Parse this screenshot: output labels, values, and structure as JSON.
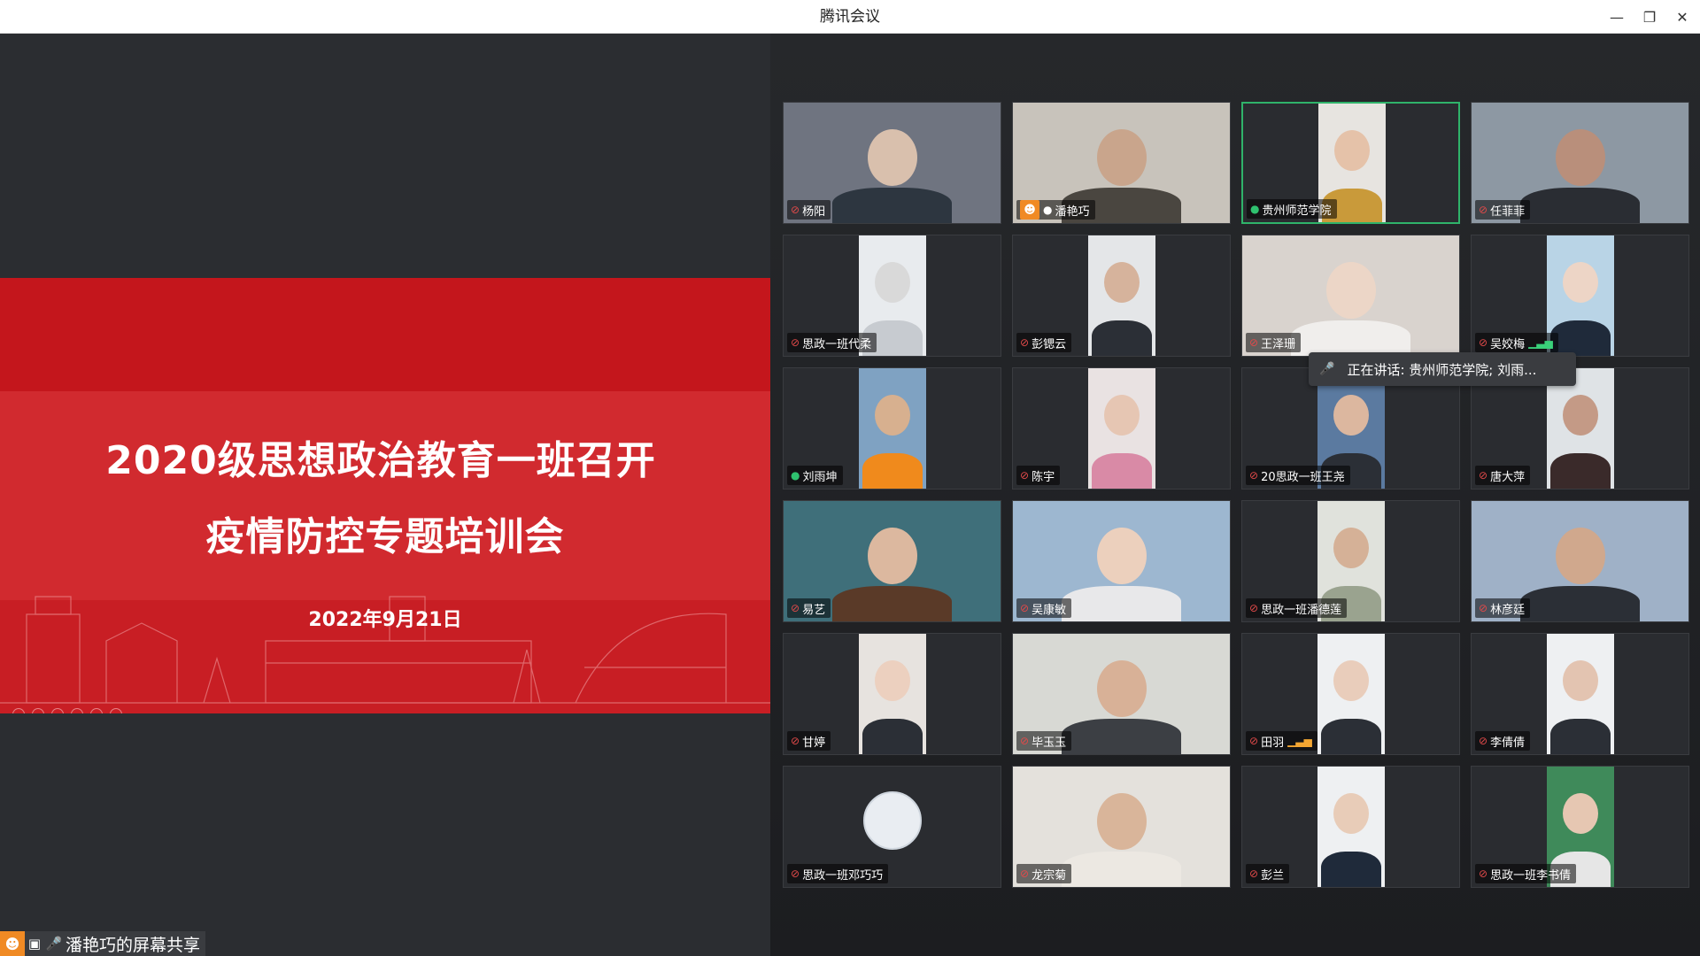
{
  "window": {
    "title": "腾讯会议",
    "minimize_label": "—",
    "maximize_label": "❐",
    "close_label": "✕"
  },
  "slide": {
    "title_line1": "2020级思想政治教育一班召开",
    "title_line2": "疫情防控专题培训会",
    "date": "2022年9月21日"
  },
  "share_label": "潘艳巧的屏幕共享",
  "speaking_tooltip": "正在讲话: 贵州师范学院; 刘雨...",
  "participants": [
    {
      "name": "杨阳",
      "mic": "muted",
      "host": false,
      "active": false,
      "bg": "#6f7480",
      "skin": "#d9c0ad",
      "shirt": "#2d3640",
      "narrow": false
    },
    {
      "name": "潘艳巧",
      "mic": "white",
      "host": true,
      "active": false,
      "bg": "#c8c3bb",
      "skin": "#c9a58c",
      "shirt": "#4a4640",
      "narrow": false
    },
    {
      "name": "贵州师范学院",
      "mic": "on",
      "host": false,
      "active": true,
      "bg": "#e7e4e0",
      "skin": "#e5c2a9",
      "shirt": "#c99a3a",
      "narrow": true
    },
    {
      "name": "任菲菲",
      "mic": "muted",
      "host": false,
      "active": false,
      "bg": "#8d98a3",
      "skin": "#b98f7b",
      "shirt": "#2a2d33",
      "narrow": false
    },
    {
      "name": "思政一班代柔",
      "mic": "muted",
      "host": false,
      "active": false,
      "bg": "#e8ebee",
      "skin": "#d9d9d9",
      "shirt": "#c7cbd0",
      "narrow": true
    },
    {
      "name": "彭锶云",
      "mic": "muted",
      "host": false,
      "active": false,
      "bg": "#e4e6e8",
      "skin": "#d6b39c",
      "shirt": "#2b2f36",
      "narrow": true
    },
    {
      "name": "王泽珊",
      "mic": "muted",
      "host": false,
      "active": false,
      "bg": "#d9d3ce",
      "skin": "#ecd6c7",
      "shirt": "#f0eeec",
      "narrow": false
    },
    {
      "name": "吴姣梅",
      "mic": "muted",
      "bars": "green",
      "host": false,
      "active": false,
      "bg": "#b9d4e6",
      "skin": "#edd5c6",
      "shirt": "#1f2a3a",
      "narrow": true
    },
    {
      "name": "刘雨坤",
      "mic": "on",
      "host": false,
      "active": false,
      "bg": "#7fa2c2",
      "skin": "#d7b08f",
      "shirt": "#f08a1c",
      "narrow": true
    },
    {
      "name": "陈宇",
      "mic": "muted",
      "host": false,
      "active": false,
      "bg": "#e9e2e2",
      "skin": "#e6c6b3",
      "shirt": "#d98aa6",
      "narrow": true
    },
    {
      "name": "20思政一班王尧",
      "mic": "muted",
      "host": false,
      "active": false,
      "bg": "#5b7aa0",
      "skin": "#dcb79f",
      "shirt": "#2b2f36",
      "narrow": true
    },
    {
      "name": "唐大萍",
      "mic": "muted",
      "host": false,
      "active": false,
      "bg": "#dfe3e6",
      "skin": "#c49a86",
      "shirt": "#3a2a2a",
      "narrow": true
    },
    {
      "name": "易艺",
      "mic": "muted",
      "host": false,
      "active": false,
      "bg": "#3f6f7a",
      "skin": "#dcb89f",
      "shirt": "#5a3a28",
      "narrow": false
    },
    {
      "name": "吴康敏",
      "mic": "muted",
      "host": false,
      "active": false,
      "bg": "#9db7d0",
      "skin": "#ecd0bd",
      "shirt": "#e8e8ea",
      "narrow": false
    },
    {
      "name": "思政一班潘德莲",
      "mic": "muted",
      "host": false,
      "active": false,
      "bg": "#e0e2dc",
      "skin": "#d5b197",
      "shirt": "#9aa38f",
      "narrow": true
    },
    {
      "name": "林彦廷",
      "mic": "muted",
      "host": false,
      "active": false,
      "bg": "#9fb1c7",
      "skin": "#d0a88d",
      "shirt": "#2b2f36",
      "narrow": false
    },
    {
      "name": "甘婷",
      "mic": "muted",
      "host": false,
      "active": false,
      "bg": "#e7e3df",
      "skin": "#ecd0bf",
      "shirt": "#2b2f36",
      "narrow": true
    },
    {
      "name": "毕玉玉",
      "mic": "muted",
      "host": false,
      "active": false,
      "bg": "#d8d9d4",
      "skin": "#d8b197",
      "shirt": "#3c3f44",
      "narrow": false
    },
    {
      "name": "田羽",
      "mic": "muted",
      "bars": "orange",
      "host": false,
      "active": false,
      "bg": "#eef0f2",
      "skin": "#e9cdbb",
      "shirt": "#2b2f36",
      "narrow": true
    },
    {
      "name": "李倩倩",
      "mic": "muted",
      "host": false,
      "active": false,
      "bg": "#eef0f2",
      "skin": "#e3c4b1",
      "shirt": "#2b2f36",
      "narrow": true
    },
    {
      "name": "思政一班邓巧巧",
      "mic": "muted",
      "host": false,
      "active": false,
      "bg": "#2a2c30",
      "avatar_only": true
    },
    {
      "name": "龙宗菊",
      "mic": "muted",
      "host": false,
      "active": false,
      "bg": "#e4e1dc",
      "skin": "#d9b59a",
      "shirt": "#ece8e2",
      "narrow": false
    },
    {
      "name": "彭兰",
      "mic": "muted",
      "host": false,
      "active": false,
      "bg": "#eef0f2",
      "skin": "#e8ccb8",
      "shirt": "#1f2a3a",
      "narrow": true
    },
    {
      "name": "思政一班李书倩",
      "mic": "muted",
      "host": false,
      "active": false,
      "bg": "#3f8a5a",
      "skin": "#e6c7b2",
      "shirt": "#e6e6e6",
      "narrow": true
    }
  ]
}
